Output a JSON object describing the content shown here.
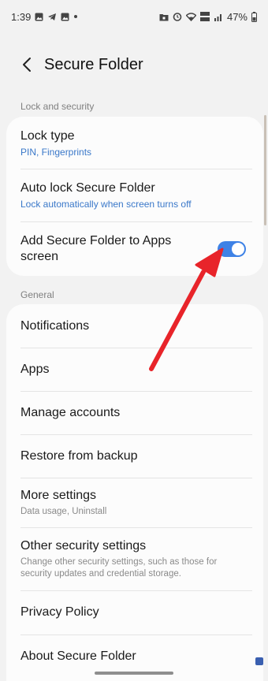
{
  "status_bar": {
    "time": "1:39",
    "left_icons": [
      "gallery-icon",
      "telegram-icon",
      "gallery-icon",
      "dot-icon"
    ],
    "right_icons": [
      "folder-lock-icon",
      "alarm-icon",
      "wifi-icon",
      "volte-lte-icon",
      "signal-icon"
    ],
    "battery": "47%"
  },
  "header": {
    "title": "Secure Folder"
  },
  "sections": {
    "lock_security": {
      "title": "Lock and security",
      "lock_type": {
        "label": "Lock type",
        "sub": "PIN, Fingerprints"
      },
      "auto_lock": {
        "label": "Auto lock Secure Folder",
        "sub": "Lock automatically when screen turns off"
      },
      "add_to_apps": {
        "label": "Add Secure Folder to Apps screen",
        "toggle_on": true
      }
    },
    "general": {
      "title": "General",
      "items": [
        {
          "label": "Notifications"
        },
        {
          "label": "Apps"
        },
        {
          "label": "Manage accounts"
        },
        {
          "label": "Restore from backup"
        },
        {
          "label": "More settings",
          "sub": "Data usage, Uninstall"
        },
        {
          "label": "Other security settings",
          "sub": "Change other security settings, such as those for security updates and credential storage."
        },
        {
          "label": "Privacy Policy"
        },
        {
          "label": "About Secure Folder"
        }
      ]
    }
  },
  "colors": {
    "accent": "#3e82e6",
    "sub_link": "#3a78c9",
    "annotation_arrow": "#e8242a",
    "background": "#f2f2f2",
    "card": "#fcfcfc"
  }
}
